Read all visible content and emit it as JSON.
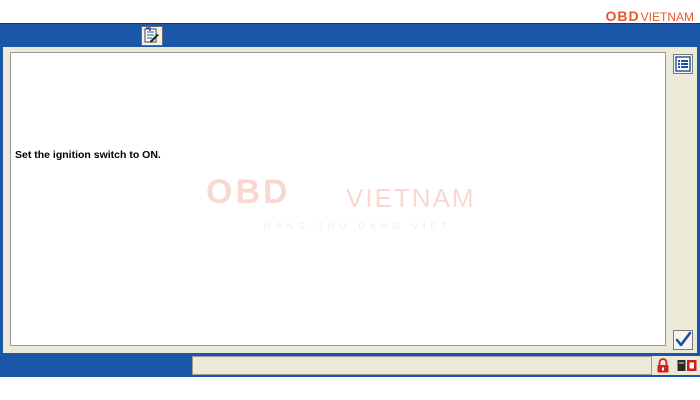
{
  "logo": {
    "brand": "OBD",
    "name": "VIETNAM",
    "tagline": "HANG THU DANG VIET"
  },
  "titlebar": {
    "icon": "back-page-icon"
  },
  "content": {
    "message": "Set the ignition switch to ON."
  },
  "buttons": {
    "list_icon": "list-icon",
    "ok_icon": "checkmark-icon"
  },
  "statusbar": {
    "text": "",
    "lock_icon": "lock-icon",
    "connection_icon": "vehicle-connection-icon"
  },
  "colors": {
    "window_blue": "#1a57a8",
    "panel_beige": "#ece9d8",
    "brand_orange": "#e8562a",
    "check_blue": "#1a4fa0",
    "lock_red": "#d42020"
  }
}
